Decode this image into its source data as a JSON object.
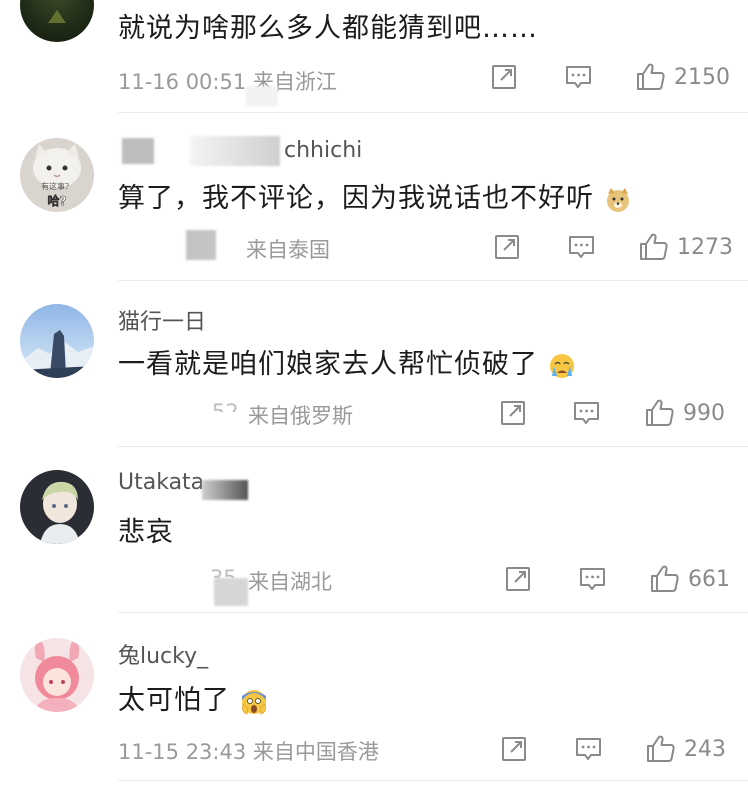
{
  "comments": [
    {
      "username": "",
      "content": "就说为啥那么多人都能猜到吧……",
      "meta": "11-16 00:51 来自浙江",
      "likes": "2150",
      "avatar_icon": "dark-avatar"
    },
    {
      "username": "chhichi",
      "content": "算了，我不评论，因为我说话也不好听",
      "meta": "来自泰国",
      "likes": "1273",
      "avatar_icon": "cat-avatar",
      "avatar_text_top": "有这事？",
      "avatar_text_bottom": "哈?"
    },
    {
      "username": "猫行一日",
      "content": "一看就是咱们娘家去人帮忙侦破了",
      "meta": "来自俄罗斯",
      "meta_prefix": "52",
      "likes": "990",
      "avatar_icon": "mountain-avatar"
    },
    {
      "username": "Utakata",
      "content": "悲哀",
      "meta": "来自湖北",
      "meta_prefix": "35",
      "likes": "661",
      "avatar_icon": "anime-boy-avatar"
    },
    {
      "username": "兔lucky_",
      "content": "太可怕了",
      "meta": "11-15 23:43 来自中国香港",
      "likes": "243",
      "avatar_icon": "pink-anime-avatar"
    }
  ],
  "icons": {
    "share": "share-icon",
    "comment": "comment-icon",
    "like": "thumbs-up-icon",
    "doge": "doge-emoji",
    "cry": "crying-emoji",
    "scream": "scream-emoji"
  }
}
